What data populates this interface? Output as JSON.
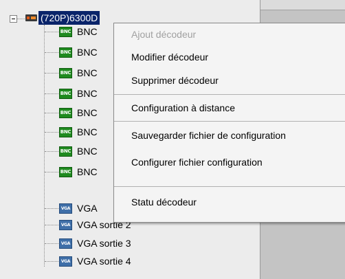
{
  "tree": {
    "root_label": "(720P)6300D",
    "bnc_icon_text": "BNC",
    "vga_icon_text": "VGA",
    "bnc_items": [
      "BNC",
      "BNC",
      "BNC",
      "BNC",
      "BNC",
      "BNC",
      "BNC",
      "BNC"
    ],
    "vga_items": [
      "VGA",
      "VGA sortie 2",
      "VGA sortie 3",
      "VGA sortie 4"
    ]
  },
  "context_menu": {
    "items": [
      {
        "label": "Ajout décodeur",
        "enabled": false
      },
      {
        "label": "Modifier décodeur",
        "enabled": true
      },
      {
        "label": "Supprimer décodeur",
        "enabled": true
      },
      {
        "label": "Configuration à distance",
        "enabled": true
      },
      {
        "label": "Sauvegarder fichier de configuration",
        "enabled": true
      },
      {
        "label": "Configurer fichier configuration",
        "enabled": true
      },
      {
        "label": "Statu décodeur",
        "enabled": true
      }
    ]
  }
}
